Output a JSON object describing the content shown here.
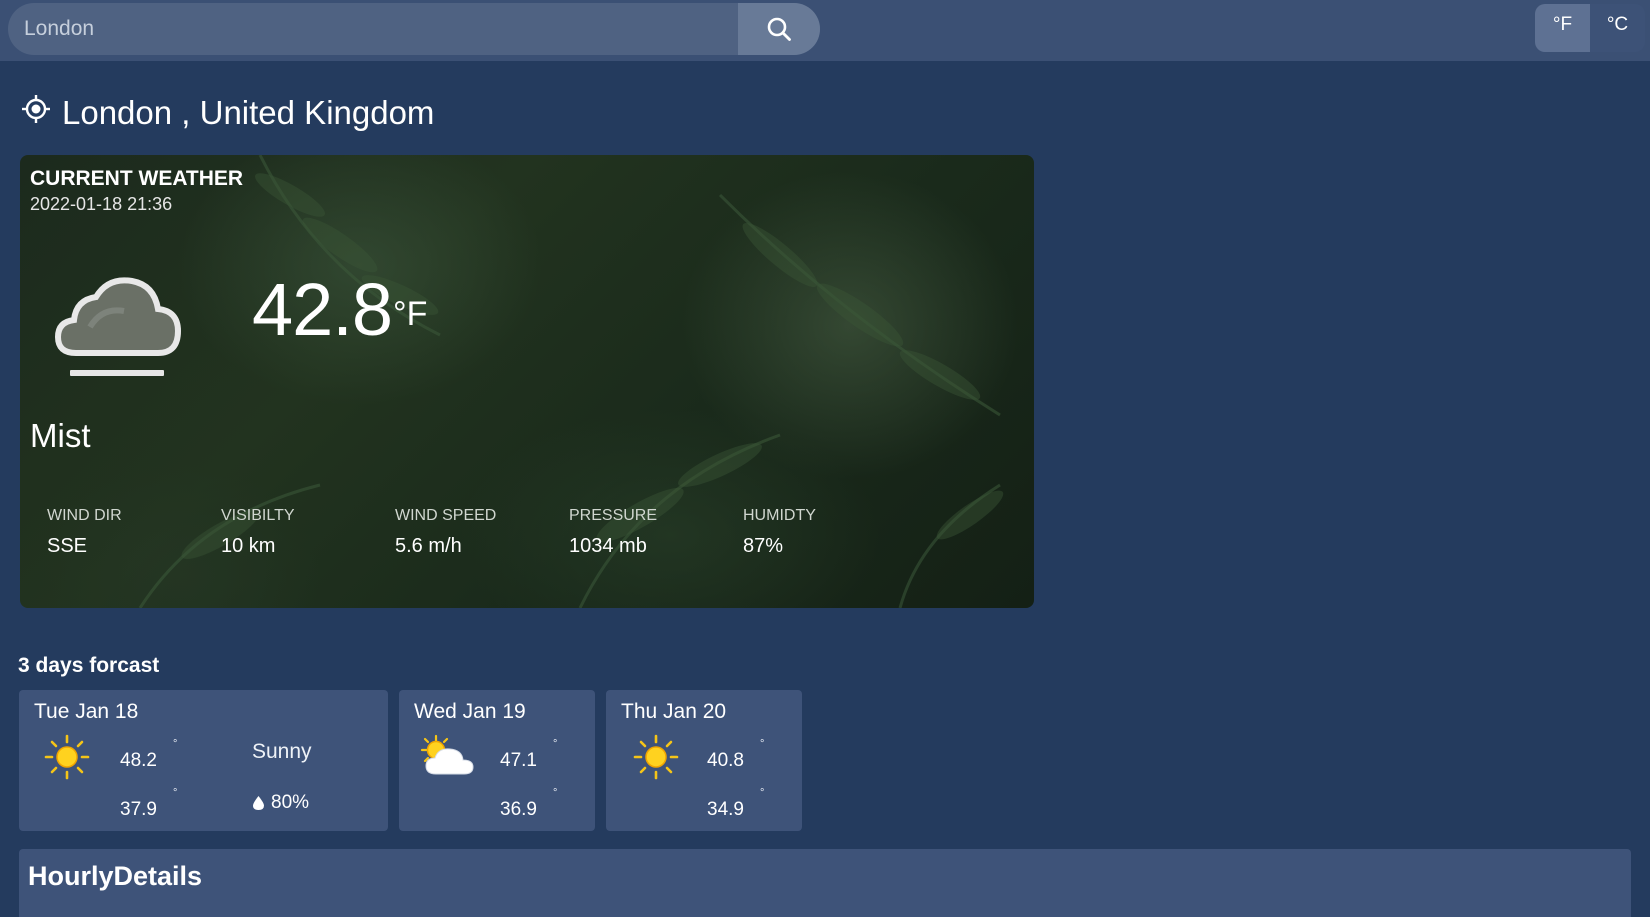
{
  "search": {
    "placeholder": "London",
    "value": ""
  },
  "units": {
    "fahrenheit": "°F",
    "celsius": "°C",
    "selected": "F"
  },
  "location": {
    "title": "London , United Kingdom"
  },
  "current": {
    "heading": "CURRENT WEATHER",
    "datetime": "2022-01-18 21:36",
    "temperature": "42.8",
    "unit": "°F",
    "condition": "Mist",
    "icon": "mist-cloud-icon",
    "stats": [
      {
        "label": "WIND DIR",
        "value": "SSE"
      },
      {
        "label": "VISIBILTY",
        "value": "10 km"
      },
      {
        "label": "WIND SPEED",
        "value": "5.6 m/h"
      },
      {
        "label": "PRESSURE",
        "value": "1034 mb"
      },
      {
        "label": "HUMIDTY",
        "value": "87%"
      }
    ]
  },
  "forecast": {
    "title": "3 days forcast",
    "days": [
      {
        "date": "Tue Jan 18",
        "icon": "sun-icon",
        "max": "48.2",
        "min": "37.9",
        "condition": "Sunny",
        "rain": "80%"
      },
      {
        "date": "Wed Jan 19",
        "icon": "partly-cloudy-icon",
        "max": "47.1",
        "min": "36.9"
      },
      {
        "date": "Thu Jan 20",
        "icon": "sun-icon",
        "max": "40.8",
        "min": "34.9"
      }
    ]
  },
  "hourly": {
    "title": "HourlyDetails"
  },
  "colors": {
    "page_bg": "#243b5e",
    "topbar": "#3b5074",
    "card": "#3e5379",
    "sun": "#f5c518"
  }
}
